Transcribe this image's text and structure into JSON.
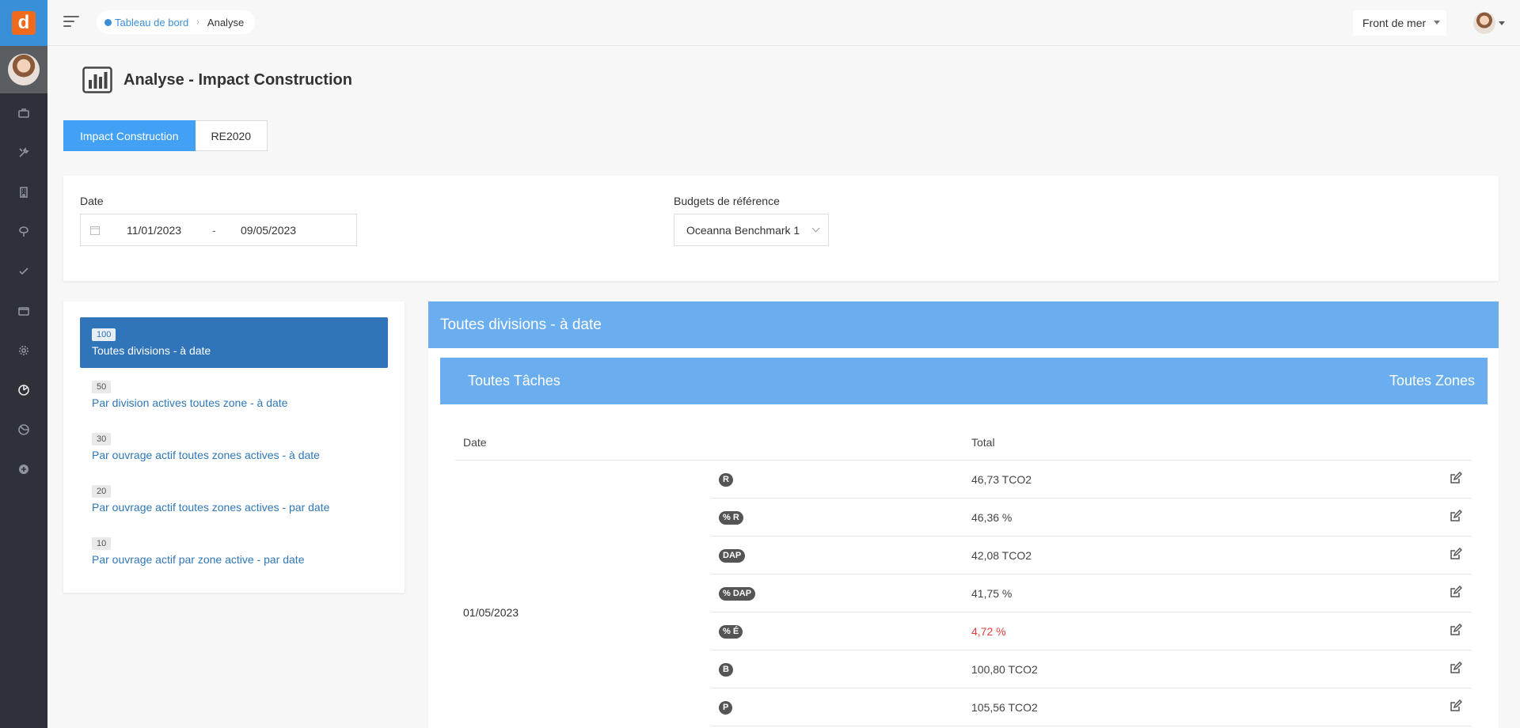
{
  "app": {
    "logo_letter": "d"
  },
  "sidebar": {
    "items": [
      {
        "icon": "briefcase-icon"
      },
      {
        "icon": "tools-icon"
      },
      {
        "icon": "building-icon"
      },
      {
        "icon": "tree-icon"
      },
      {
        "icon": "check-icon"
      },
      {
        "icon": "folder-icon"
      },
      {
        "icon": "gear-icon"
      },
      {
        "icon": "analytics-icon",
        "active": true
      },
      {
        "icon": "chart-pie-icon"
      },
      {
        "icon": "plus-circle-icon"
      }
    ]
  },
  "topbar": {
    "breadcrumb": {
      "home": "Tableau de bord",
      "current": "Analyse"
    },
    "project": "Front de mer"
  },
  "page": {
    "title": "Analyse - Impact Construction"
  },
  "tabs": [
    {
      "label": "Impact Construction",
      "active": true
    },
    {
      "label": "RE2020",
      "active": false
    }
  ],
  "filters": {
    "date_label": "Date",
    "date_start": "11/01/2023",
    "date_end": "09/05/2023",
    "date_separator": "-",
    "budget_label": "Budgets de référence",
    "budget_value": "Oceanna Benchmark 1"
  },
  "reports": [
    {
      "badge": "100",
      "label": "Toutes divisions - à date",
      "active": true
    },
    {
      "badge": "50",
      "label": "Par division actives toutes zone - à date",
      "active": false
    },
    {
      "badge": "30",
      "label": "Par ouvrage actif toutes zones actives - à date",
      "active": false
    },
    {
      "badge": "20",
      "label": "Par ouvrage actif toutes zones actives - par date",
      "active": false
    },
    {
      "badge": "10",
      "label": "Par ouvrage actif par zone active - par date",
      "active": false
    }
  ],
  "main": {
    "header": "Toutes divisions - à date",
    "sub_left": "Toutes Tâches",
    "sub_right": "Toutes Zones",
    "columns": {
      "date": "Date",
      "total": "Total"
    },
    "date_value": "01/05/2023",
    "rows": [
      {
        "tag": "R",
        "value": "46,73 TCO2",
        "alert": false
      },
      {
        "tag": "% R",
        "value": "46,36 %",
        "alert": false
      },
      {
        "tag": "DAP",
        "value": "42,08 TCO2",
        "alert": false
      },
      {
        "tag": "% DAP",
        "value": "41,75 %",
        "alert": false
      },
      {
        "tag": "% É",
        "value": "4,72 %",
        "alert": true
      },
      {
        "tag": "B",
        "value": "100,80 TCO2",
        "alert": false
      },
      {
        "tag": "P",
        "value": "105,56 TCO2",
        "alert": false
      }
    ]
  },
  "colors": {
    "primary": "#42a0f5",
    "panel_header": "#6aaef0",
    "active_item": "#3074b9",
    "alert": "#e53b3b",
    "sidebar": "#2e3238"
  }
}
